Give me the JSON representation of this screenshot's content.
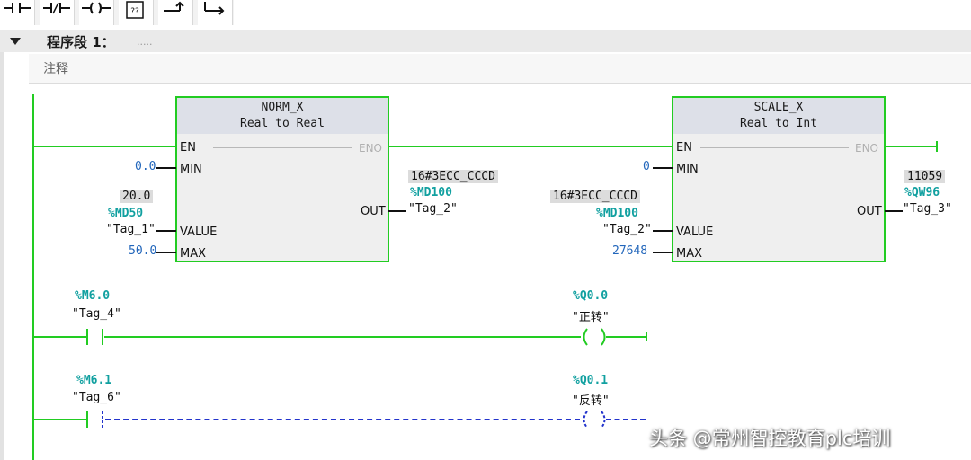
{
  "toolbar": {
    "items": [
      {
        "icon": "no-contact-icon",
        "label": "⊣⊢"
      },
      {
        "icon": "nc-contact-icon",
        "label": "⊣/⊢"
      },
      {
        "icon": "coil-icon",
        "label": "–()–"
      },
      {
        "icon": "empty-box-icon",
        "label": "??"
      },
      {
        "icon": "open-branch-icon",
        "label": "↱"
      },
      {
        "icon": "close-branch-icon",
        "label": "↳"
      }
    ]
  },
  "network": {
    "title": "程序段 1：",
    "title_comment": ".....",
    "comment": "注释"
  },
  "norm_x": {
    "name": "NORM_X",
    "types": "Real to Real",
    "pins": {
      "en": "EN",
      "eno": "ENO",
      "min": "MIN",
      "value": "VALUE",
      "max": "MAX",
      "out": "OUT"
    },
    "min_value": "0.0",
    "value_monitor": "20.0",
    "value_address": "%MD50",
    "value_tag": "\"Tag_1\"",
    "max_value": "50.0",
    "out_monitor": "16#3ECC_CCCD",
    "out_address": "%MD100",
    "out_tag": "\"Tag_2\""
  },
  "scale_x": {
    "name": "SCALE_X",
    "types": "Real to Int",
    "pins": {
      "en": "EN",
      "eno": "ENO",
      "min": "MIN",
      "value": "VALUE",
      "max": "MAX",
      "out": "OUT"
    },
    "min_value": "0",
    "value_monitor": "16#3ECC_CCCD",
    "value_address": "%MD100",
    "value_tag": "\"Tag_2\"",
    "max_value": "27648",
    "out_monitor": "11059",
    "out_address": "%QW96",
    "out_tag": "\"Tag_3\""
  },
  "rung2": {
    "contact_address": "%M6.0",
    "contact_tag": "\"Tag_4\"",
    "coil_address": "%Q0.0",
    "coil_tag": "\"正转\""
  },
  "rung3": {
    "contact_address": "%M6.1",
    "contact_tag": "\"Tag_6\"",
    "coil_address": "%Q0.1",
    "coil_tag": "\"反转\""
  },
  "watermark": "头条 @常州智控教育plc培训",
  "colors": {
    "energized": "#22cc22",
    "unpowered": "#2233cc",
    "address": "#11a0a0",
    "constant": "#2266bb"
  }
}
